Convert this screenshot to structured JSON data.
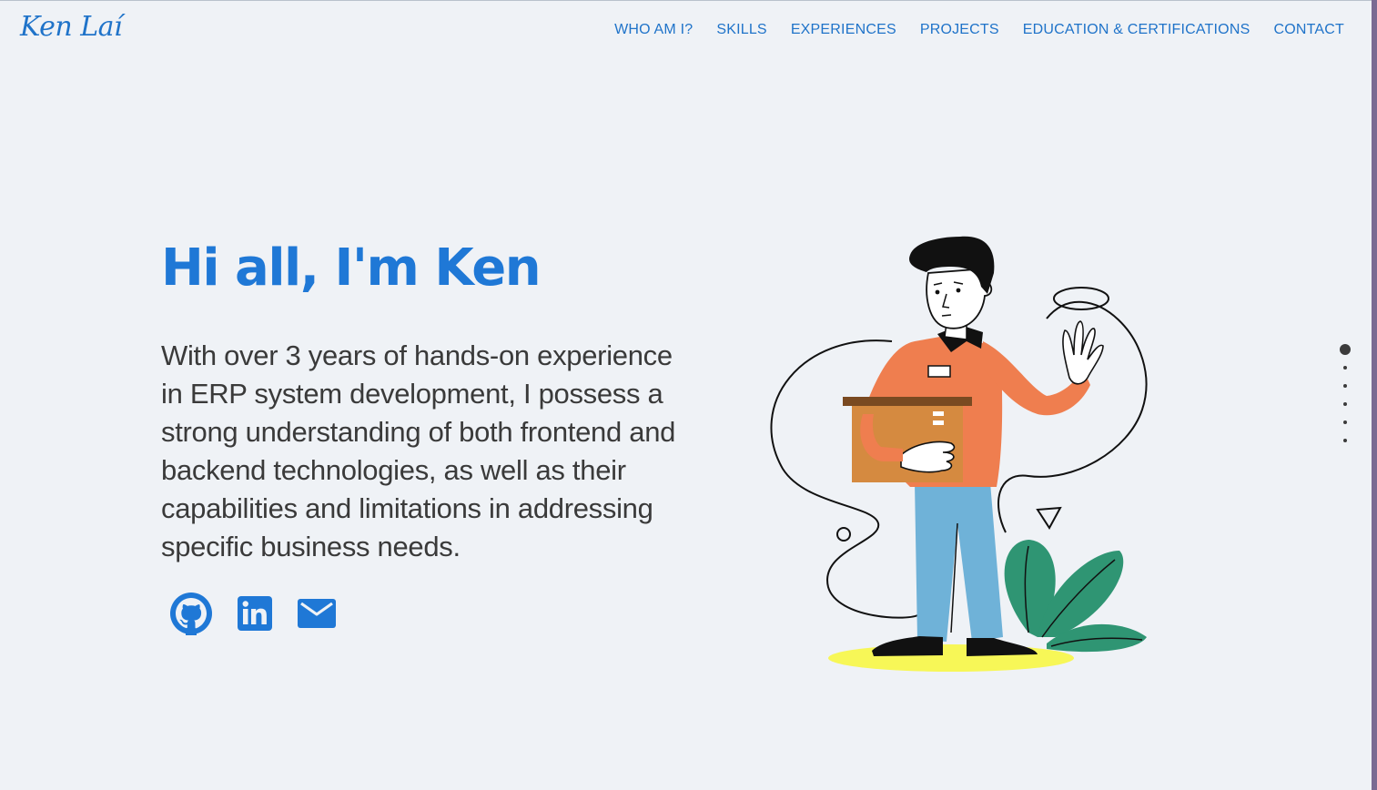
{
  "header": {
    "logo_text": "Ken Laí",
    "nav": [
      {
        "label": "WHO AM I?"
      },
      {
        "label": "SKILLS"
      },
      {
        "label": "EXPERIENCES"
      },
      {
        "label": "PROJECTS"
      },
      {
        "label": "EDUCATION & CERTIFICATIONS"
      },
      {
        "label": "CONTACT"
      }
    ]
  },
  "hero": {
    "title": "Hi all, I'm Ken",
    "description": "With over 3 years of hands-on experience in ERP system development, I possess a strong understanding of both frontend and backend technologies, as well as their capabilities and limitations in addressing specific business needs."
  },
  "socials": [
    {
      "icon": "github-icon"
    },
    {
      "icon": "linkedin-icon"
    },
    {
      "icon": "mail-icon"
    }
  ],
  "section_nav": {
    "count": 6,
    "active_index": 0
  },
  "colors": {
    "accent": "#1f78d6",
    "background": "#eff2f6",
    "text": "#3a3a3a"
  }
}
